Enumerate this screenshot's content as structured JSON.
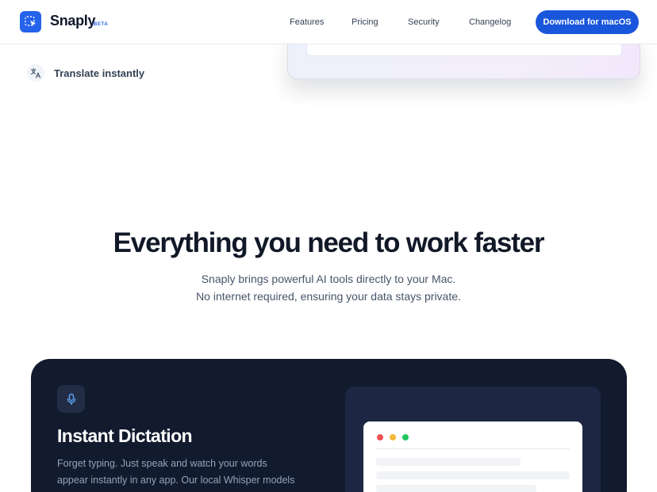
{
  "header": {
    "brand": "Snaply",
    "badge": "BETA",
    "nav": [
      "Features",
      "Pricing",
      "Security",
      "Changelog"
    ],
    "cta": "Download for macOS"
  },
  "features_list": {
    "translate_label": "Translate instantly",
    "translate_icon": "translate-icon"
  },
  "section": {
    "title": "Everything you need to work faster",
    "subtitle_lines": [
      "Snaply brings powerful AI tools directly to your Mac.",
      "No internet required, ensuring your data stays private."
    ]
  },
  "feature_card": {
    "icon": "microphone-icon",
    "title": "Instant Dictation",
    "description_lines": [
      "Forget typing. Just speak and watch your words",
      "appear instantly in any app. Our local Whisper models"
    ]
  },
  "colors": {
    "accent": "#1a56db",
    "brand_blue": "#2563eb",
    "card_dark": "#121a2e",
    "window_dot_red": "#f05252",
    "window_dot_yellow": "#f5b83d",
    "window_dot_green": "#22c55e"
  }
}
